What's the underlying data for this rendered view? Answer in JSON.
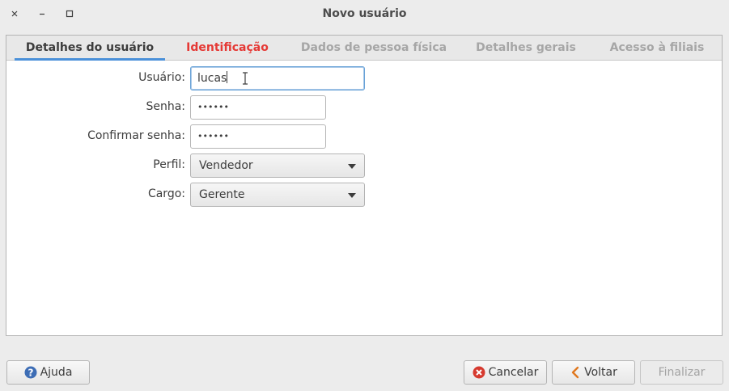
{
  "window": {
    "title": "Novo usuário"
  },
  "tabs": [
    {
      "label": "Detalhes do usuário",
      "state": "active"
    },
    {
      "label": "Identificação",
      "state": "error"
    },
    {
      "label": "Dados de pessoa física",
      "state": "disabled"
    },
    {
      "label": "Detalhes gerais",
      "state": "disabled"
    },
    {
      "label": "Acesso à filiais",
      "state": "disabled"
    }
  ],
  "form": {
    "usuario": {
      "label": "Usuário:",
      "value": "lucas"
    },
    "senha": {
      "label": "Senha:",
      "value": "••••••"
    },
    "confirmar": {
      "label": "Confirmar senha:",
      "value": "••••••"
    },
    "perfil": {
      "label": "Perfil:",
      "value": "Vendedor"
    },
    "cargo": {
      "label": "Cargo:",
      "value": "Gerente"
    }
  },
  "buttons": {
    "help": "Ajuda",
    "cancel": "Cancelar",
    "back": "Voltar",
    "finish": "Finalizar"
  },
  "colors": {
    "accent": "#4a90d9",
    "error": "#e53935",
    "disabled": "#a6a6a6"
  },
  "icons": [
    "close-icon",
    "minimize-icon",
    "maximize-icon",
    "help-icon",
    "cancel-icon",
    "back-arrow-icon",
    "text-cursor-icon"
  ]
}
